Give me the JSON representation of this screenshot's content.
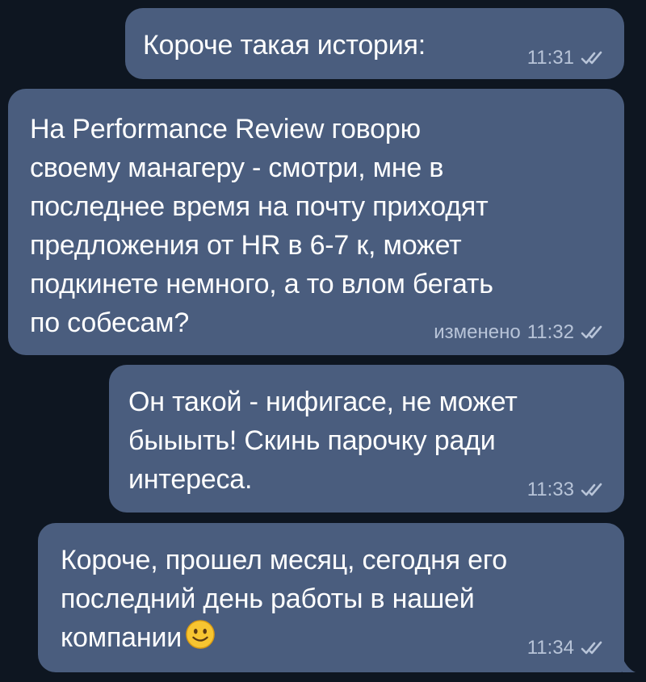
{
  "colors": {
    "background": "#0e1621",
    "bubble": "#4a5d7e",
    "meta_text": "#b8c4d8"
  },
  "messages": [
    {
      "text": "Короче такая история:",
      "edited_label": "",
      "time": "11:31",
      "status_icon": "double-check-icon"
    },
    {
      "text": "На Performance Review говорю\nсвоему манагеру - смотри, мне в\nпоследнее время на почту приходят\nпредложения от HR в 6-7 к, может\nподкинете немного, а то влом бегать\nпо собесам?",
      "edited_label": "изменено",
      "time": "11:32",
      "status_icon": "double-check-icon"
    },
    {
      "text": "Он такой - нифигасе, не может\nбыыыть! Скинь парочку ради\nинтереса.",
      "edited_label": "",
      "time": "11:33",
      "status_icon": "double-check-icon"
    },
    {
      "text": "Короче, прошел месяц, сегодня его\nпоследний день работы в нашей\nкомпании",
      "emoji": "slightly-smiling-face-emoji",
      "edited_label": "",
      "time": "11:34",
      "status_icon": "double-check-icon"
    }
  ]
}
